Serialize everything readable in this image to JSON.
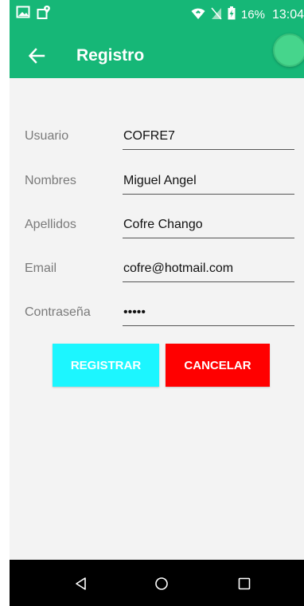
{
  "status_bar": {
    "battery": "16%",
    "time": "13:04",
    "icons": [
      "image-icon",
      "location-alert-icon",
      "wifi-icon",
      "no-sim-icon",
      "battery-charging-icon"
    ]
  },
  "app_bar": {
    "title": "Registro",
    "back_icon": "arrow-left-icon",
    "accent": "#16b777"
  },
  "form": {
    "fields": [
      {
        "label": "Usuario",
        "value": "COFRE7"
      },
      {
        "label": "Nombres",
        "value": "Miguel Angel"
      },
      {
        "label": "Apellidos",
        "value": "Cofre Chango"
      },
      {
        "label": "Email",
        "value": "cofre@hotmail.com"
      },
      {
        "label": "Contraseña",
        "value": "•••••"
      }
    ],
    "register_label": "REGISTRAR",
    "cancel_label": "CANCELAR",
    "register_color": "#1cf6ff",
    "cancel_color": "#ff0000"
  },
  "nav_bar": {
    "icons": [
      "back-triangle-icon",
      "home-circle-icon",
      "recents-square-icon"
    ]
  }
}
